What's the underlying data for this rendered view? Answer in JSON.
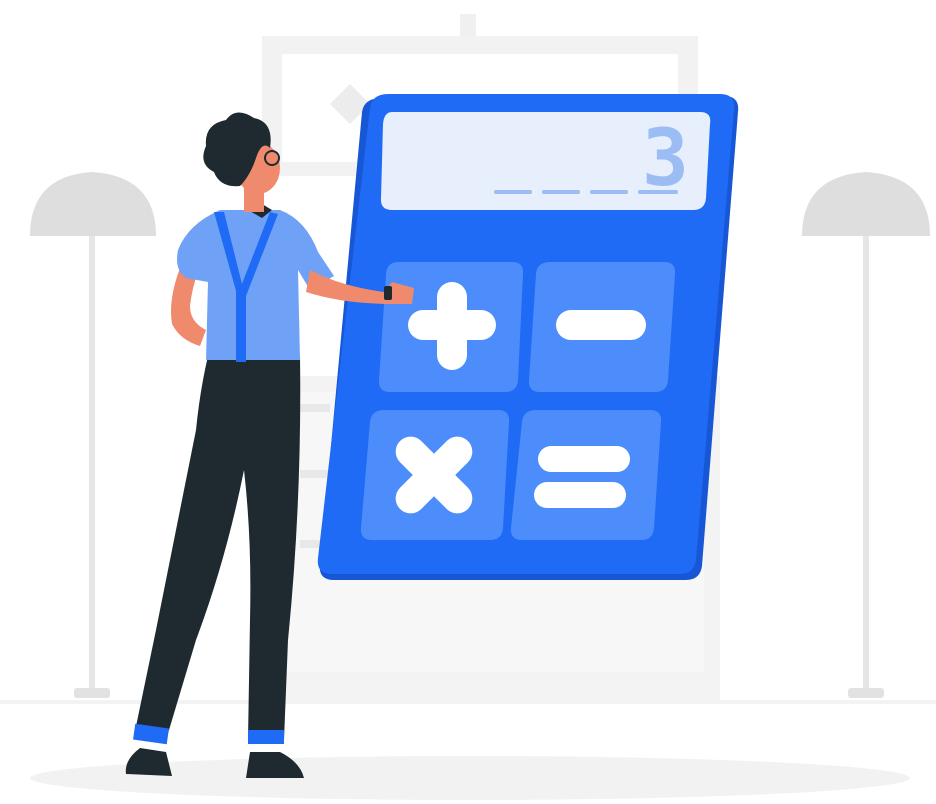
{
  "illustration": {
    "display_value": "3",
    "keys": [
      {
        "id": "plus",
        "symbol": "+",
        "icon": "plus-icon"
      },
      {
        "id": "minus",
        "symbol": "−",
        "icon": "minus-icon"
      },
      {
        "id": "multiply",
        "symbol": "×",
        "icon": "multiply-icon"
      },
      {
        "id": "equals",
        "symbol": "=",
        "icon": "equals-icon"
      }
    ],
    "colors": {
      "calculator_blue": "#1f6bf5",
      "calculator_blue_dark": "#1757d6",
      "key_blue": "#4c8dfb",
      "display_bg": "#e7eefc",
      "display_digit": "#9cbcf4",
      "shirt": "#6fa2f7",
      "suspenders": "#1f6bf5",
      "trousers": "#1f2a30",
      "hair": "#1f2a30",
      "skin": "#f08a6c",
      "background_furniture": "#efefef",
      "lamp": "#dcdcdc",
      "floor_shadow": "#f1f1f1"
    }
  }
}
